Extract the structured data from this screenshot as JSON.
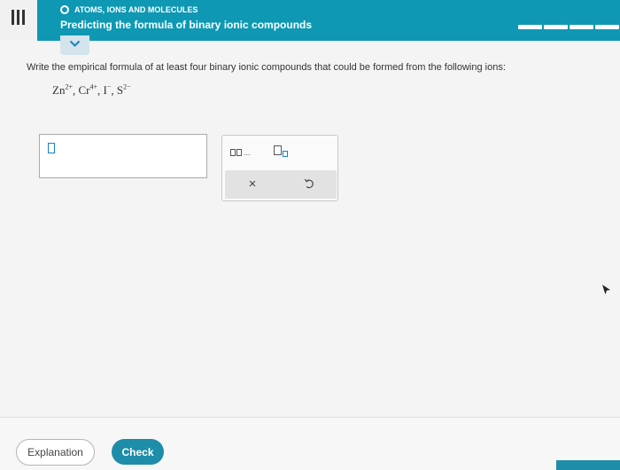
{
  "header": {
    "topic": "ATOMS, IONS AND MOLECULES",
    "title": "Predicting the formula of binary ionic compounds",
    "progress": {
      "segments_total": 4,
      "segments_filled": 4
    }
  },
  "question": {
    "instructions": "Write the empirical formula of at least four binary ionic compounds that could be formed from the following ions:",
    "ions": [
      {
        "symbol": "Zn",
        "charge": "2+"
      },
      {
        "symbol": "Cr",
        "charge": "4+"
      },
      {
        "symbol": "I",
        "charge": "−"
      },
      {
        "symbol": "S",
        "charge": "2−"
      }
    ],
    "separator": ", "
  },
  "palette": {
    "ellipsis": "..."
  },
  "footer": {
    "explanation_label": "Explanation",
    "check_label": "Check"
  },
  "colors": {
    "header_bg": "#0e98b4",
    "accent": "#1d8daa",
    "input_border": "#1a7fc1"
  },
  "icons": {
    "menu": "menu-icon",
    "status": "status-circle-icon",
    "collapse": "chevron-down-icon",
    "clear": "close-icon",
    "undo": "undo-icon",
    "cursor": "mouse-cursor-icon"
  }
}
